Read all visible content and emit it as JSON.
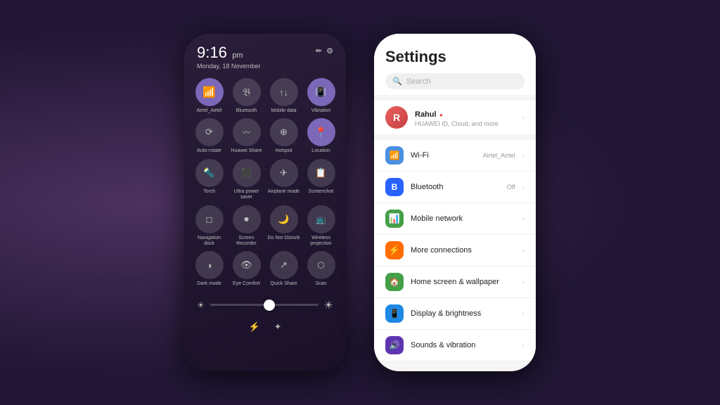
{
  "background": {
    "color": "#3d2d4e"
  },
  "left_phone": {
    "time": "9:16",
    "ampm": "pm",
    "date": "Monday, 18 November",
    "controls": [
      {
        "label": "Airtel_Airtel",
        "active": true,
        "icon": "📶"
      },
      {
        "label": "Bluetooth",
        "active": false,
        "icon": "⚡"
      },
      {
        "label": "Mobile data",
        "active": false,
        "icon": "📊"
      },
      {
        "label": "Vibration",
        "active": true,
        "icon": "📳"
      },
      {
        "label": "Auto-rotate",
        "active": false,
        "icon": "🔄"
      },
      {
        "label": "Huawei Share",
        "active": false,
        "icon": "〰"
      },
      {
        "label": "Hotspot",
        "active": false,
        "icon": "📡"
      },
      {
        "label": "Location",
        "active": true,
        "icon": "📍"
      },
      {
        "label": "Torch",
        "active": false,
        "icon": "🔦"
      },
      {
        "label": "Ultra power saver",
        "active": false,
        "icon": "⬛"
      },
      {
        "label": "Airplane mode",
        "active": false,
        "icon": "✈"
      },
      {
        "label": "Screenshot",
        "active": false,
        "icon": "📋"
      },
      {
        "label": "Navigation dock",
        "active": false,
        "icon": "◻"
      },
      {
        "label": "Screen Recorder",
        "active": false,
        "icon": "⏺"
      },
      {
        "label": "Do Not Disturb",
        "active": false,
        "icon": "🌙"
      },
      {
        "label": "Wireless projection",
        "active": false,
        "icon": "📺"
      },
      {
        "label": "Dark mode",
        "active": false,
        "icon": "◑"
      },
      {
        "label": "Eye Comfort",
        "active": false,
        "icon": "👁"
      },
      {
        "label": "Quick Share",
        "active": false,
        "icon": "↗"
      },
      {
        "label": "Scan",
        "active": false,
        "icon": "⬡"
      }
    ]
  },
  "right_phone": {
    "title": "Settings",
    "search_placeholder": "Search",
    "profile": {
      "name": "Rahul",
      "sub": "HUAWEI ID, Cloud, and more"
    },
    "settings_items": [
      {
        "label": "Wi-Fi",
        "value": "Airtel_Airtel",
        "icon_type": "wifi"
      },
      {
        "label": "Bluetooth",
        "value": "Off",
        "icon_type": "bt"
      },
      {
        "label": "Mobile network",
        "value": "",
        "icon_type": "mobile"
      },
      {
        "label": "More connections",
        "value": "",
        "icon_type": "conn"
      },
      {
        "label": "Home screen & wallpaper",
        "value": "",
        "icon_type": "home"
      },
      {
        "label": "Display & brightness",
        "value": "",
        "icon_type": "display"
      },
      {
        "label": "Sounds & vibration",
        "value": "",
        "icon_type": "sound"
      }
    ]
  }
}
